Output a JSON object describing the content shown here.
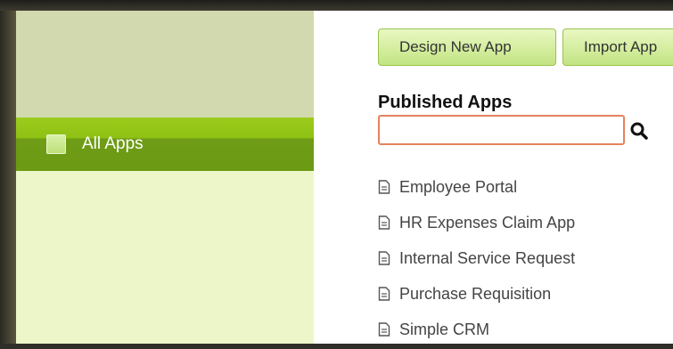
{
  "sidebar": {
    "items": [
      {
        "label": "All Apps"
      }
    ]
  },
  "toolbar": {
    "design_label": "Design New App",
    "import_label": "Import App"
  },
  "published": {
    "title": "Published Apps",
    "search": {
      "value": "",
      "placeholder": ""
    },
    "apps": [
      {
        "label": "Employee Portal",
        "icon": "document-icon"
      },
      {
        "label": "HR Expenses Claim App",
        "icon": "document-icon"
      },
      {
        "label": "Internal Service Request",
        "icon": "document-icon"
      },
      {
        "label": "Purchase Requisition",
        "icon": "document-icon"
      },
      {
        "label": "Simple CRM",
        "icon": "document-icon"
      }
    ]
  },
  "colors": {
    "sidebar_active": "#8ec114",
    "sidebar_bg": "#ecf6c9",
    "button_bg": "#c2e482",
    "search_border": "#e4825f"
  }
}
